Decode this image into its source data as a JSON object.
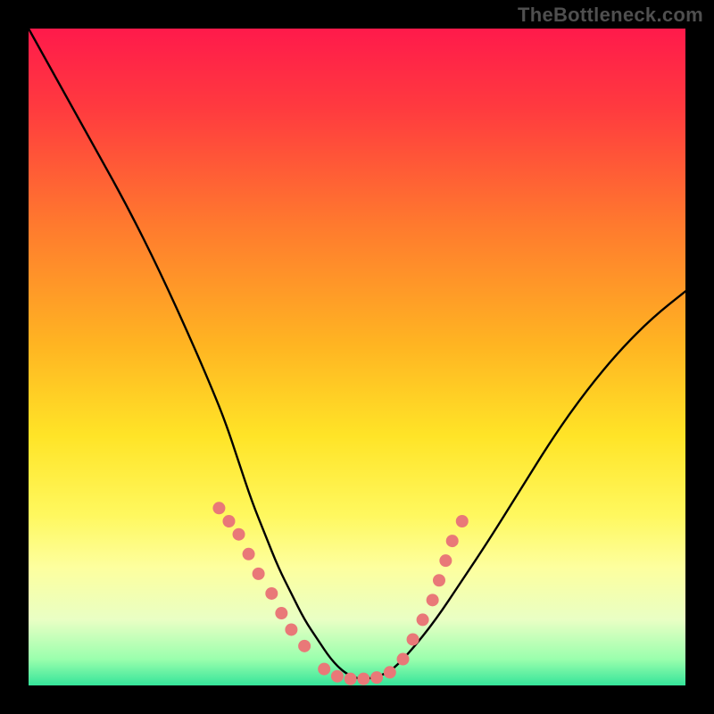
{
  "watermark": "TheBottleneck.com",
  "chart_data": {
    "type": "line",
    "title": "",
    "xlabel": "",
    "ylabel": "",
    "xlim": [
      0,
      100
    ],
    "ylim": [
      0,
      100
    ],
    "grid": false,
    "legend": "none",
    "gradient_stops": [
      {
        "offset": 0.0,
        "color": "#ff1a4b"
      },
      {
        "offset": 0.12,
        "color": "#ff3a3f"
      },
      {
        "offset": 0.3,
        "color": "#ff7a2e"
      },
      {
        "offset": 0.48,
        "color": "#ffb422"
      },
      {
        "offset": 0.62,
        "color": "#ffe427"
      },
      {
        "offset": 0.74,
        "color": "#fff85e"
      },
      {
        "offset": 0.82,
        "color": "#fdff9e"
      },
      {
        "offset": 0.9,
        "color": "#e9ffc4"
      },
      {
        "offset": 0.96,
        "color": "#9affad"
      },
      {
        "offset": 1.0,
        "color": "#35e49a"
      }
    ],
    "series": [
      {
        "name": "bottleneck-curve",
        "x": [
          0,
          5,
          10,
          15,
          20,
          25,
          28,
          30,
          32,
          34,
          36,
          38,
          40,
          42,
          44,
          46,
          48,
          50,
          52,
          55,
          58,
          62,
          66,
          70,
          75,
          80,
          85,
          90,
          95,
          100
        ],
        "y": [
          100,
          91,
          82,
          73,
          63,
          52,
          45,
          40,
          34,
          28,
          23,
          18,
          14,
          10,
          7,
          4,
          2,
          1,
          1,
          2,
          5,
          10,
          16,
          22,
          30,
          38,
          45,
          51,
          56,
          60
        ]
      }
    ],
    "markers": {
      "name": "highlight-dots",
      "color": "#e97878",
      "radius_px": 7,
      "points": [
        {
          "x": 29,
          "y": 27
        },
        {
          "x": 30.5,
          "y": 25
        },
        {
          "x": 32,
          "y": 23
        },
        {
          "x": 33.5,
          "y": 20
        },
        {
          "x": 35,
          "y": 17
        },
        {
          "x": 37,
          "y": 14
        },
        {
          "x": 38.5,
          "y": 11
        },
        {
          "x": 40,
          "y": 8.5
        },
        {
          "x": 42,
          "y": 6
        },
        {
          "x": 45,
          "y": 2.5
        },
        {
          "x": 47,
          "y": 1.4
        },
        {
          "x": 49,
          "y": 1
        },
        {
          "x": 51,
          "y": 1
        },
        {
          "x": 53,
          "y": 1.2
        },
        {
          "x": 55,
          "y": 2
        },
        {
          "x": 57,
          "y": 4
        },
        {
          "x": 58.5,
          "y": 7
        },
        {
          "x": 60,
          "y": 10
        },
        {
          "x": 61.5,
          "y": 13
        },
        {
          "x": 62.5,
          "y": 16
        },
        {
          "x": 63.5,
          "y": 19
        },
        {
          "x": 64.5,
          "y": 22
        },
        {
          "x": 66,
          "y": 25
        }
      ]
    }
  }
}
